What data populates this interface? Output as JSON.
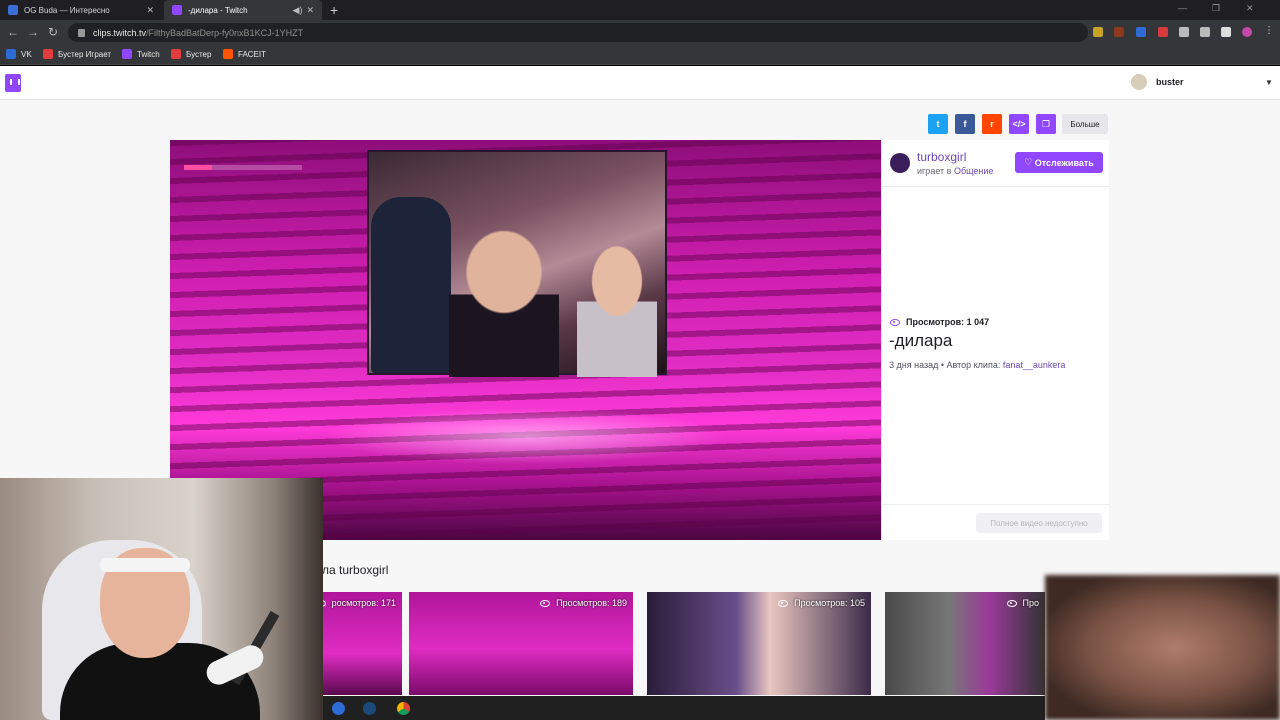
{
  "browser": {
    "tabs": [
      {
        "title": "OG Buda — Интересно",
        "favicon_color": "#3a6fd8"
      },
      {
        "title": "-дилара - Twitch",
        "favicon_color": "#9147ff"
      }
    ],
    "url_host": "clips.twitch.tv",
    "url_path": "/FilthyBadBatDerp-fy0nxB1KCJ-1YHZT",
    "bookmarks": [
      {
        "label": "VK",
        "color": "#2f6bd6"
      },
      {
        "label": "Бустер Играет",
        "color": "#e33c3c"
      },
      {
        "label": "Twitch",
        "color": "#9147ff"
      },
      {
        "label": "Бустер",
        "color": "#e33c3c"
      },
      {
        "label": "FACEIT",
        "color": "#ff5500"
      }
    ]
  },
  "twitch": {
    "username": "buster",
    "share": {
      "more_label": "Больше"
    },
    "channel": {
      "name": "turboxgirl",
      "playing_prefix": "играет в",
      "category": "Общение",
      "follow_label": "Отслеживать"
    },
    "clip": {
      "views_label": "Просмотров: 1 047",
      "title": "-дилара",
      "age": "3 дня назад",
      "author_prefix": "Автор клипа:",
      "author": "fanat__aunkera",
      "full_video_label": "Полное видео недоступно"
    },
    "more_clips_title": "ла turboxgirl",
    "cards": [
      {
        "views": "росмотров: 171"
      },
      {
        "views": "Просмотров: 189"
      },
      {
        "views": "Просмотров: 105"
      },
      {
        "views": "Про"
      }
    ]
  },
  "colors": {
    "twitch_purple": "#9147ff",
    "twitter": "#1da1f2",
    "facebook": "#3b5998",
    "reddit": "#ff4500"
  }
}
